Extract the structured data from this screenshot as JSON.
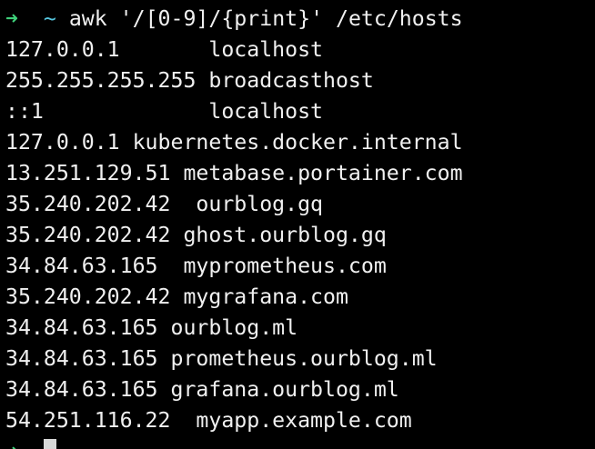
{
  "terminal": {
    "colors": {
      "background": "#000000",
      "text": "#f0f0f0",
      "prompt_arrow": "#3fd07a",
      "prompt_dir": "#56c7e0",
      "cursor": "#d8d8d8"
    },
    "prompt": {
      "arrow": "➜",
      "dir": "~",
      "command": "awk '/[0-9]/{print}' /etc/hosts"
    },
    "output_lines": [
      "127.0.0.1       localhost",
      "255.255.255.255 broadcasthost",
      "::1             localhost",
      "127.0.0.1 kubernetes.docker.internal",
      "13.251.129.51 metabase.portainer.com",
      "35.240.202.42  ourblog.gq",
      "35.240.202.42 ghost.ourblog.gq",
      "34.84.63.165  myprometheus.com",
      "35.240.202.42 mygrafana.com",
      "34.84.63.165 ourblog.ml",
      "34.84.63.165 prometheus.ourblog.ml",
      "34.84.63.165 grafana.ourblog.ml",
      "54.251.116.22  myapp.example.com"
    ],
    "next_prompt": {
      "arrow": "➜"
    }
  }
}
